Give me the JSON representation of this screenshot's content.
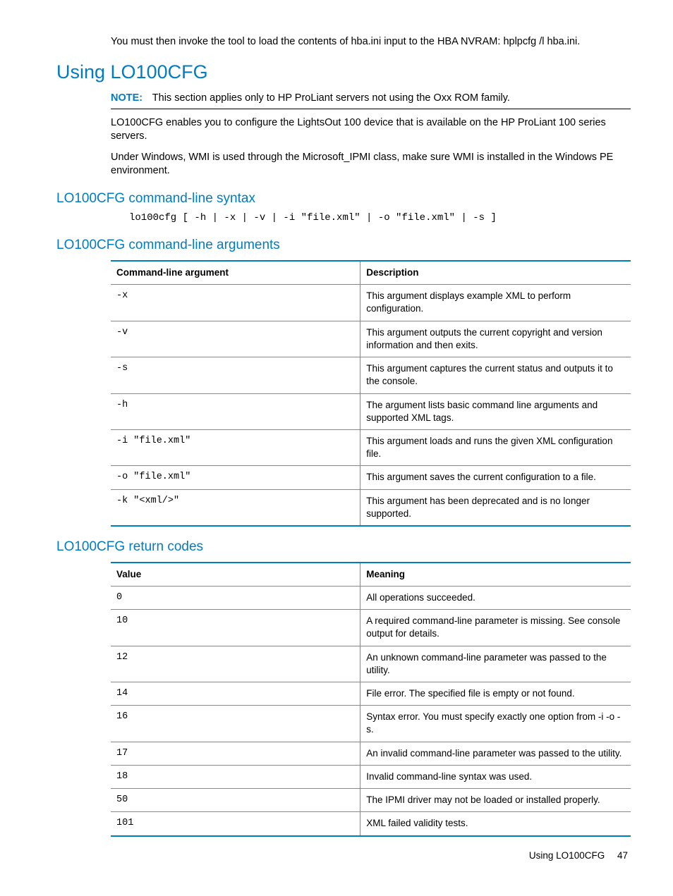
{
  "intro": "You must then invoke the tool to load the contents of hba.ini input to the HBA NVRAM: hplpcfg /l hba.ini.",
  "heading_using": "Using LO100CFG",
  "note_label": "NOTE:",
  "note_text": "This section applies only to HP ProLiant servers not using the Oxx ROM family.",
  "para1": "LO100CFG enables you to configure the LightsOut 100 device that is available on the HP ProLiant 100 series servers.",
  "para2": "Under Windows, WMI is used through the Microsoft_IPMI class, make sure WMI is installed in the Windows PE environment.",
  "heading_syntax": "LO100CFG command-line syntax",
  "syntax_code": "lo100cfg [ -h | -x | -v | -i \"file.xml\" | -o \"file.xml\" | -s ]",
  "heading_args": "LO100CFG command-line arguments",
  "args_table": {
    "head_arg": "Command-line argument",
    "head_desc": "Description",
    "rows": [
      {
        "arg": "-x",
        "desc": "This argument displays example XML to perform configuration."
      },
      {
        "arg": "-v",
        "desc": "This argument outputs the current copyright and version information and then exits."
      },
      {
        "arg": "-s",
        "desc": "This argument captures the current status and outputs it to the console."
      },
      {
        "arg": "-h",
        "desc": "The argument lists basic command line arguments and supported XML tags."
      },
      {
        "arg": "-i \"file.xml\"",
        "desc": "This argument loads and runs the given XML configuration file."
      },
      {
        "arg": "-o \"file.xml\"",
        "desc": "This argument saves the current configuration to a file."
      },
      {
        "arg": "-k \"<xml/>\"",
        "desc": "This argument has been deprecated and is no longer supported."
      }
    ]
  },
  "heading_return": "LO100CFG return codes",
  "return_table": {
    "head_val": "Value",
    "head_meaning": "Meaning",
    "rows": [
      {
        "val": "0",
        "meaning": "All operations succeeded."
      },
      {
        "val": "10",
        "meaning": "A required command-line parameter is missing. See console output for details."
      },
      {
        "val": "12",
        "meaning": "An unknown command-line parameter was passed to the utility."
      },
      {
        "val": "14",
        "meaning": "File error. The specified file is empty or not found."
      },
      {
        "val": "16",
        "meaning": "Syntax error. You must specify exactly one option from -i -o -s."
      },
      {
        "val": "17",
        "meaning": "An invalid command-line parameter was passed to the utility."
      },
      {
        "val": "18",
        "meaning": "Invalid command-line syntax was used."
      },
      {
        "val": "50",
        "meaning": "The IPMI driver may not be loaded or installed properly."
      },
      {
        "val": "101",
        "meaning": "XML failed validity tests."
      }
    ]
  },
  "footer_label": "Using LO100CFG",
  "footer_page": "47"
}
